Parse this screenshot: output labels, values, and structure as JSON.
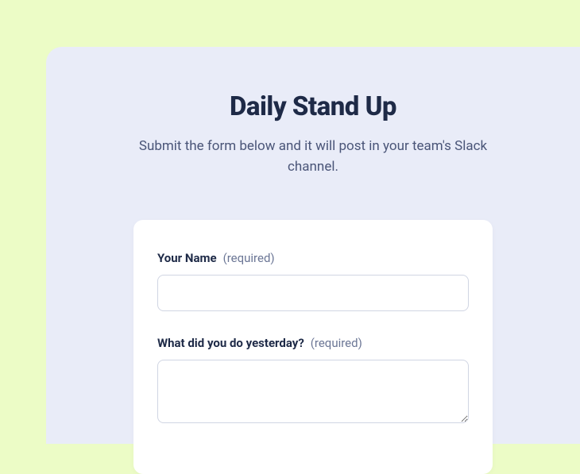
{
  "header": {
    "title": "Daily Stand Up",
    "subtitle": "Submit the form below and it will post in your team's Slack channel."
  },
  "form": {
    "fields": [
      {
        "label": "Your Name",
        "required_text": "(required)"
      },
      {
        "label": "What did you do yesterday?",
        "required_text": "(required)"
      }
    ]
  }
}
